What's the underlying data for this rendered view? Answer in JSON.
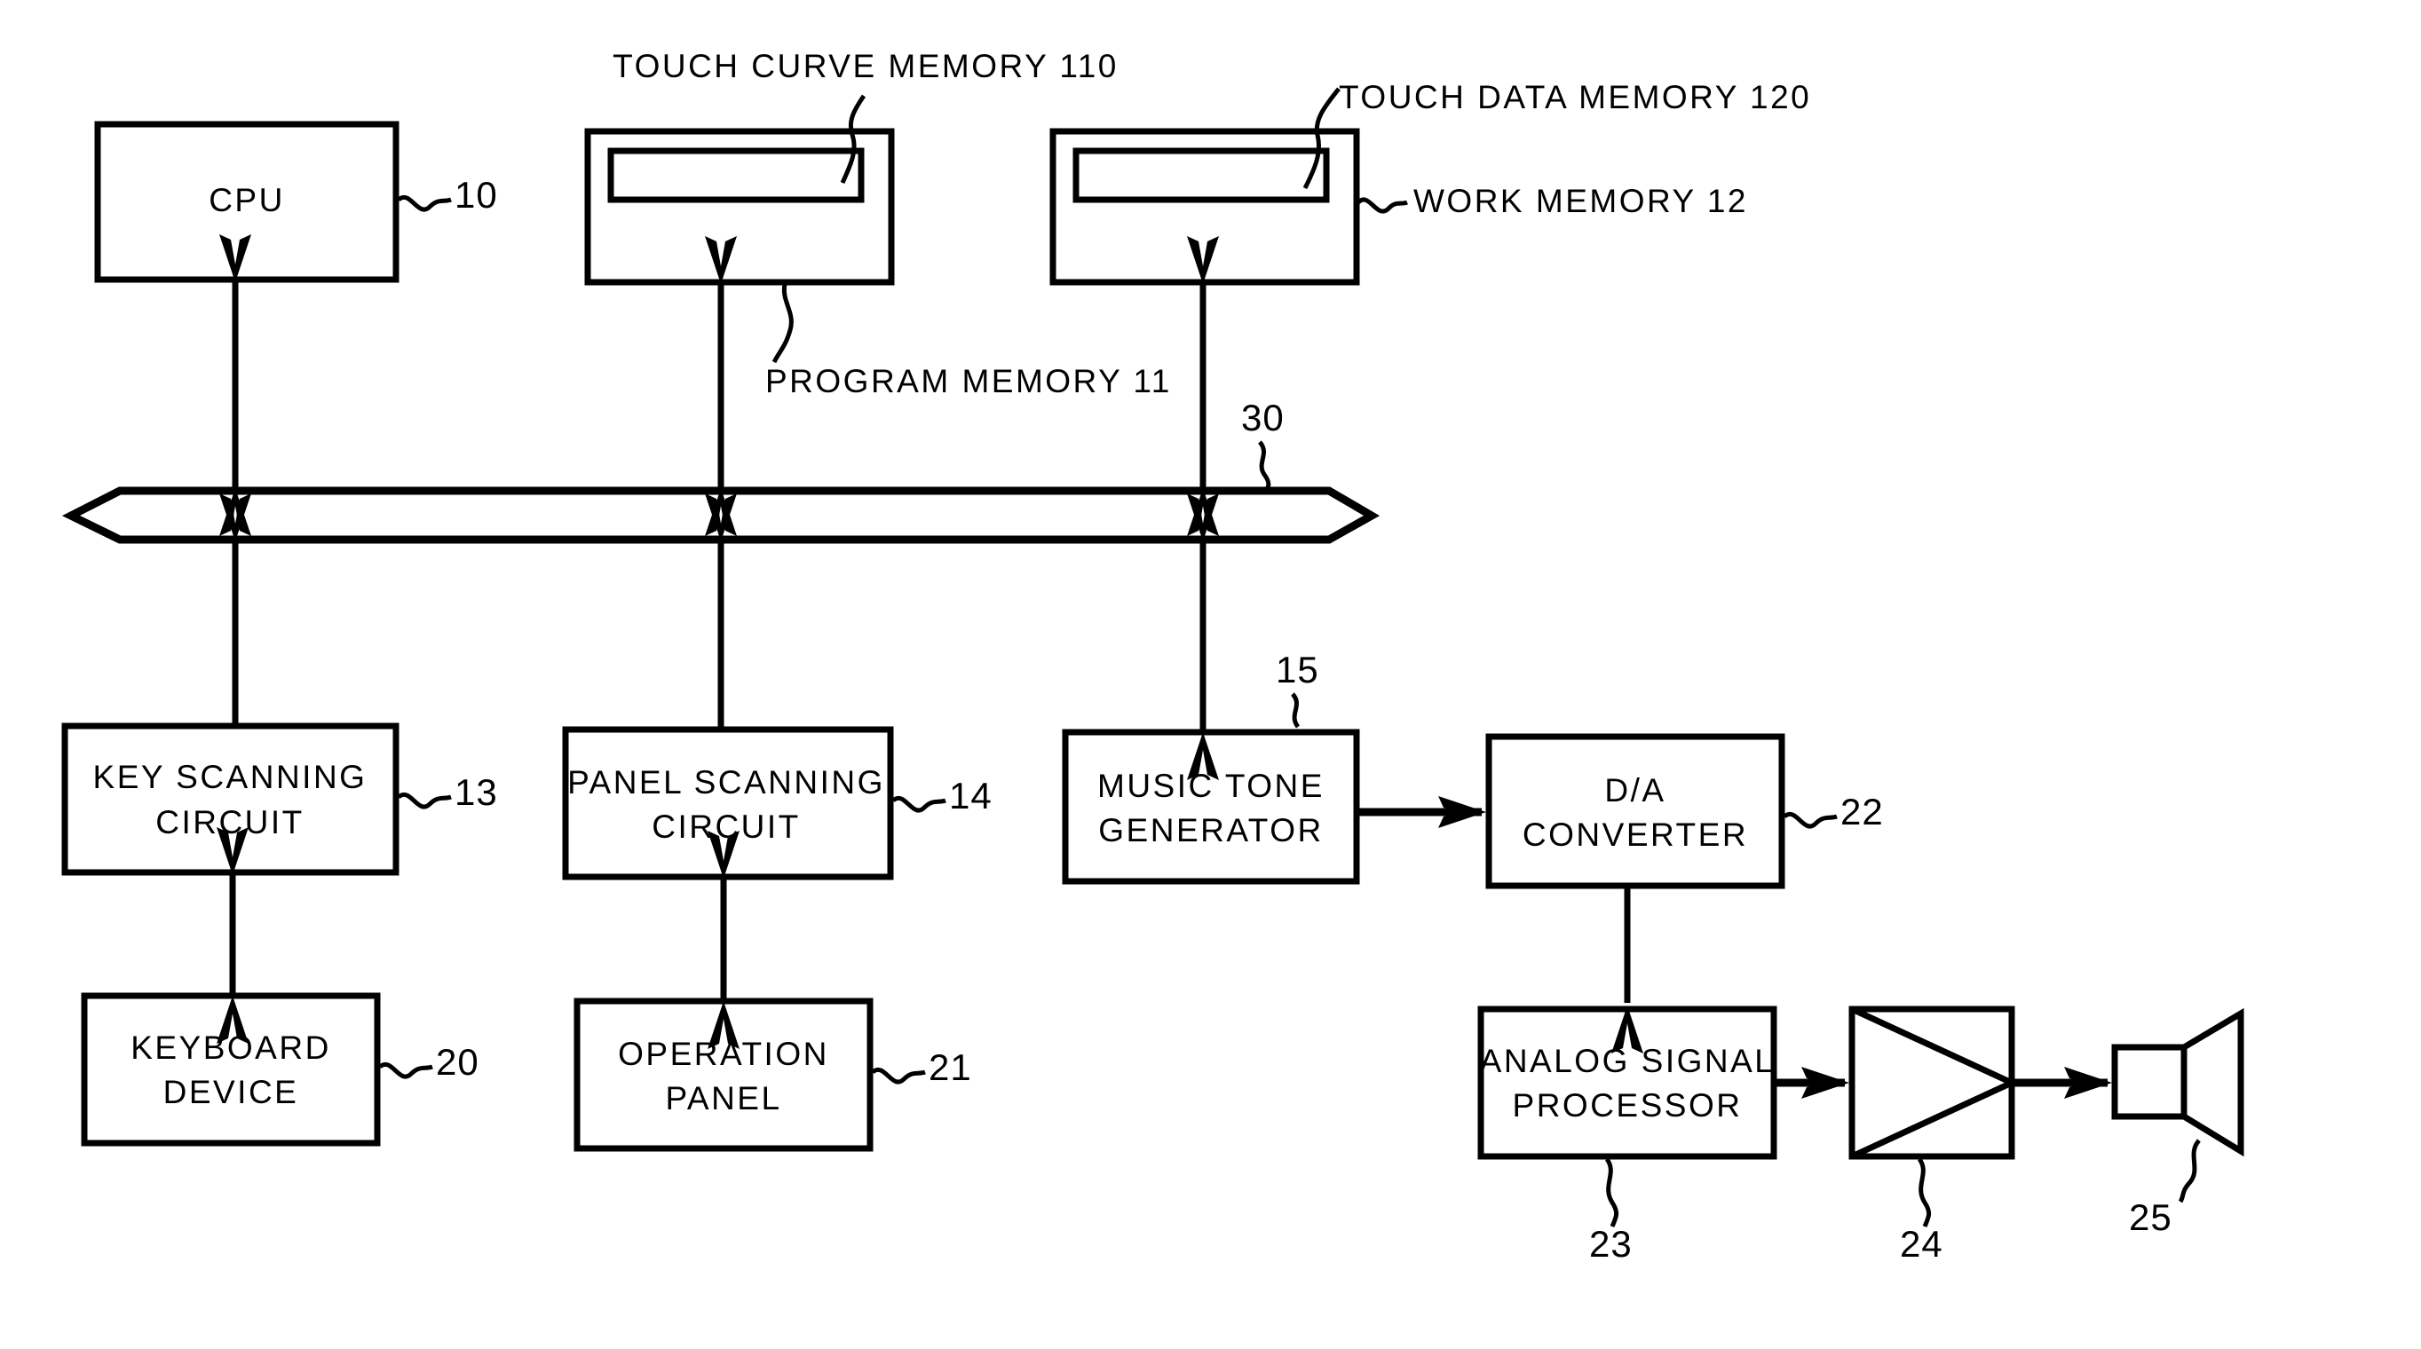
{
  "figure": {
    "type": "patent-block-diagram",
    "background_color": "#ffffff",
    "line_color": "#000000"
  },
  "blocks": {
    "cpu": {
      "label": "CPU",
      "ref": "10"
    },
    "program_memory": {
      "label": "",
      "ref": "11",
      "ref_label": "PROGRAM MEMORY 11"
    },
    "touch_curve_memory": {
      "label": "",
      "ref": "110",
      "ref_label": "TOUCH CURVE MEMORY 110"
    },
    "work_memory": {
      "label": "",
      "ref": "12",
      "ref_label": "WORK MEMORY 12"
    },
    "touch_data_memory": {
      "label": "",
      "ref": "120",
      "ref_label": "TOUCH DATA MEMORY 120"
    },
    "bus": {
      "ref": "30"
    },
    "key_scanning_circuit": {
      "line1": "KEY SCANNING",
      "line2": "CIRCUIT",
      "ref": "13"
    },
    "panel_scanning_circuit": {
      "line1": "PANEL SCANNING",
      "line2": "CIRCUIT",
      "ref": "14"
    },
    "music_tone_generator": {
      "line1": "MUSIC TONE",
      "line2": "GENERATOR",
      "ref": "15"
    },
    "keyboard_device": {
      "line1": "KEYBOARD",
      "line2": "DEVICE",
      "ref": "20"
    },
    "operation_panel": {
      "line1": "OPERATION",
      "line2": "PANEL",
      "ref": "21"
    },
    "da_converter": {
      "line1": "D/A",
      "line2": "CONVERTER",
      "ref": "22"
    },
    "analog_signal_processor": {
      "line1": "ANALOG SIGNAL",
      "line2": "PROCESSOR",
      "ref": "23"
    },
    "amplifier": {
      "label": "",
      "ref": "24"
    },
    "speaker": {
      "label": "",
      "ref": "25"
    }
  }
}
